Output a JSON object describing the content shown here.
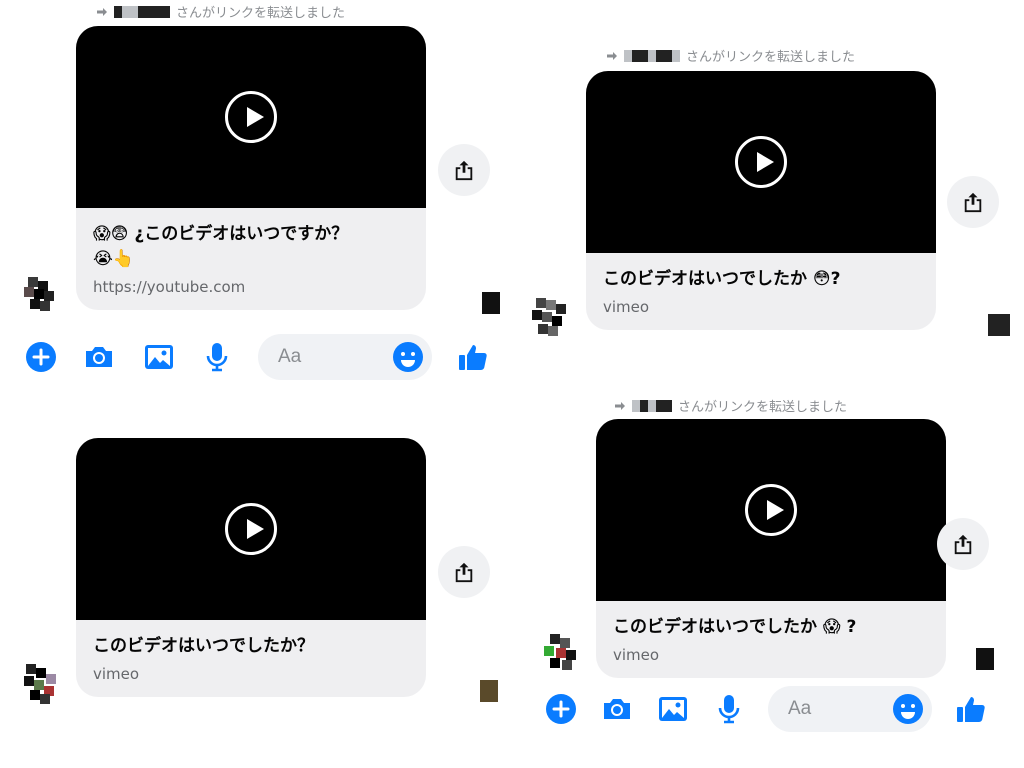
{
  "forward_notice": "さんがリンクを転送しました",
  "accent": "#0a7cff",
  "panels": [
    {
      "title": "😱😨 ¿このビデオはいつですか？ 😭👆",
      "title_line1": "😱😨 ¿このビデオはいつですか？",
      "title_line2": "😭👆",
      "source": "https://youtube.com"
    },
    {
      "title": "このビデオはいつでしたか 😳?",
      "source": "vimeo"
    },
    {
      "title": "このビデオはいつでしたか？",
      "source": "vimeo"
    },
    {
      "title": "このビデオはいつでしたか 😱 ?",
      "source": "vimeo"
    }
  ],
  "composer": {
    "placeholder": "Aa",
    "icons": [
      "plus-icon",
      "camera-icon",
      "gallery-icon",
      "microphone-icon",
      "emoji-icon",
      "thumbs-up-icon"
    ]
  }
}
